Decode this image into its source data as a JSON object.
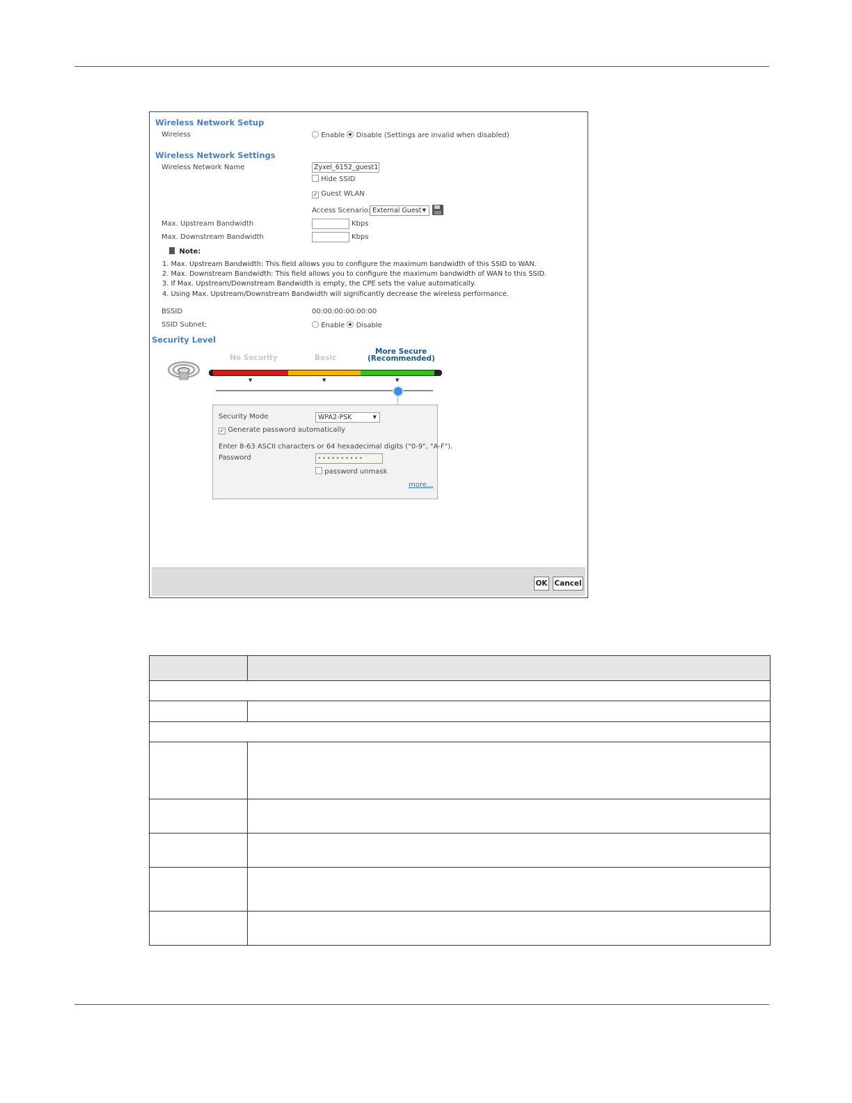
{
  "wireless_network_setup": {
    "title": "Wireless Network Setup",
    "wireless_label": "Wireless",
    "enable_label": "Enable",
    "disable_label": "Disable (Settings are invalid when disabled)",
    "selected": "Disable"
  },
  "wireless_network_settings": {
    "title": "Wireless Network Settings",
    "network_name_label": "Wireless Network Name",
    "network_name_value": "Zyxel_6152_guest1",
    "hide_ssid_label": "Hide SSID",
    "hide_ssid_checked": false,
    "guest_wlan_label": "Guest WLAN",
    "guest_wlan_checked": true,
    "access_scenario_label": "Access Scenario:",
    "access_scenario_value": "External Guest",
    "save_icon": "floppy-disk-icon",
    "max_upstream_label": "Max. Upstream Bandwidth",
    "max_upstream_value": "",
    "max_downstream_label": "Max. Downstream Bandwidth",
    "max_downstream_value": "",
    "unit": "Kbps",
    "note_title": "Note:",
    "notes": [
      "1. Max. Upstream Bandwidth: This field allows you to configure the maximum bandwidth of this SSID to WAN.",
      "2. Max. Downstream Bandwidth: This field allows you to configure the maximum bandwidth of WAN to this SSID.",
      "3. If Max. Upstream/Downstream Bandwidth is empty, the CPE sets the value automatically.",
      "4. Using Max. Upstream/Downstream Bandwidth will significantly decrease the wireless performance."
    ],
    "bssid_label": "BSSID",
    "bssid_value": "00:00:00:00:00:00",
    "ssid_subnet_label": "SSID Subnet:",
    "ssid_subnet_enable": "Enable",
    "ssid_subnet_disable": "Disable",
    "ssid_subnet_selected": "Disable"
  },
  "security_level": {
    "title": "Security Level",
    "levels": [
      "No Security",
      "Basic",
      "More Secure",
      "(Recommended)"
    ],
    "selected_level": "More Secure",
    "colors": {
      "no_security": "#d21c1c",
      "basic": "#f5b400",
      "more_secure": "#35c01a",
      "slider_knob": "#3a8fe0"
    },
    "security_mode_label": "Security Mode",
    "security_mode_value": "WPA2-PSK",
    "generate_password_label": "Generate password automatically",
    "generate_password_checked": true,
    "hint": "Enter 8-63 ASCII characters or 64 hexadecimal digits (\"0-9\", \"A-F\").",
    "password_label": "Password",
    "password_value": "••••••••••",
    "unmask_label": "password unmask",
    "more_link": "more..."
  },
  "footer": {
    "ok_label": "OK",
    "cancel_label": "Cancel"
  }
}
